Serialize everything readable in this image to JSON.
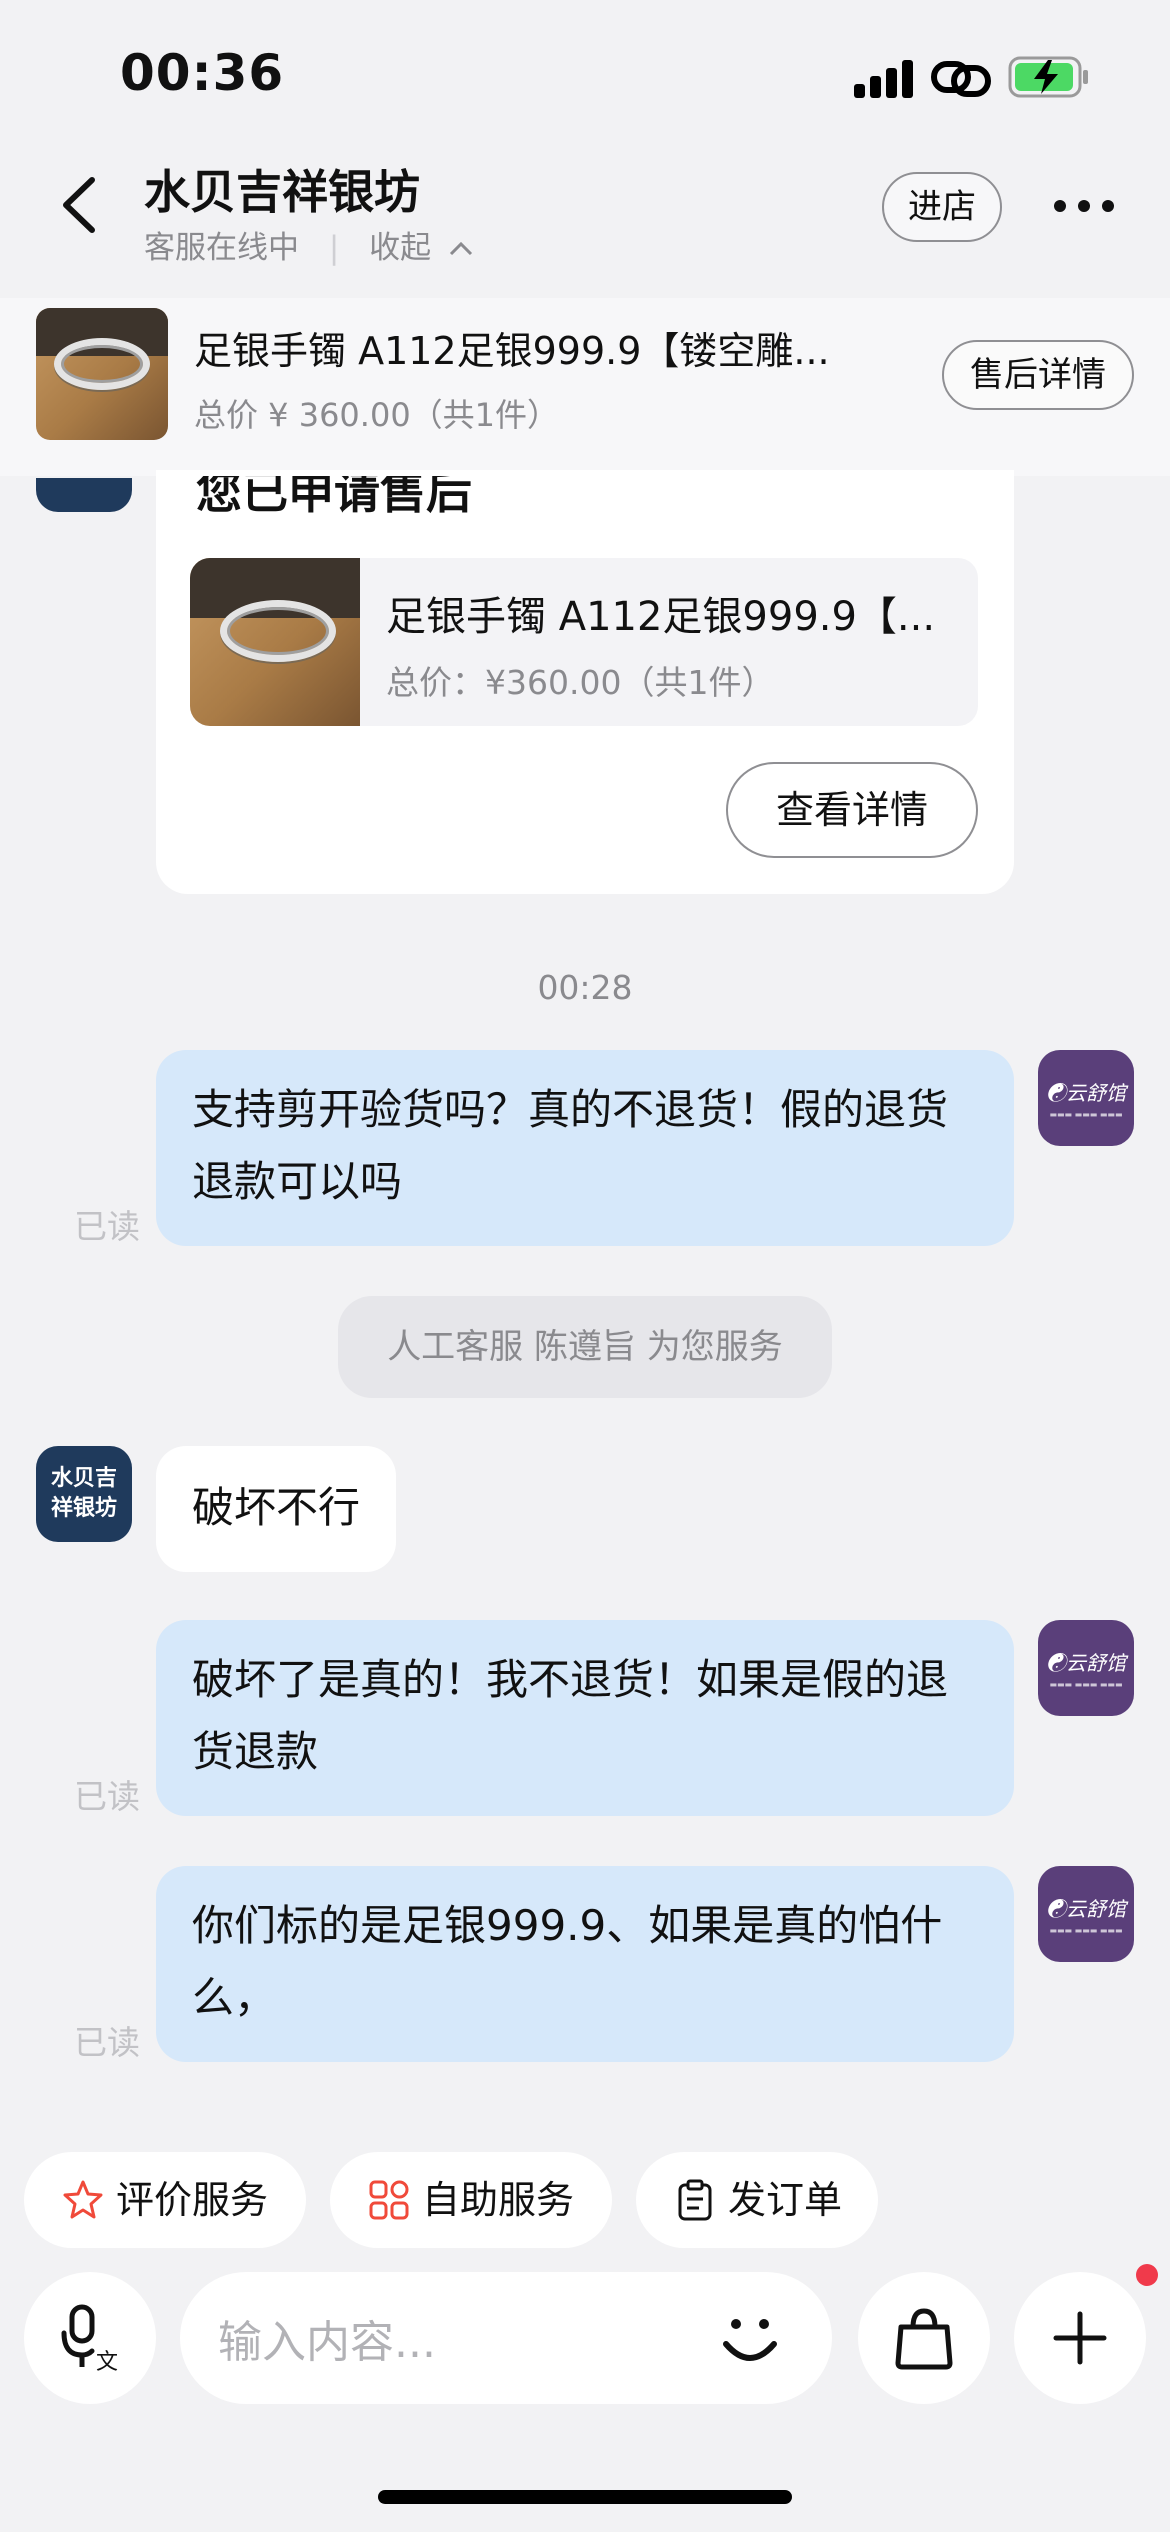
{
  "status_bar": {
    "time": "00:36"
  },
  "header": {
    "back_icon": "chevron-left-icon",
    "title": "水贝吉祥银坊",
    "status": "客服在线中",
    "collapse_label": "收起",
    "enter_shop": "进店",
    "more_icon": "more-dots-icon"
  },
  "product_bar": {
    "title": "足银手镯 A112足银999.9【镂空雕...",
    "price": "总价 ¥ 360.00（共1件）",
    "aftersale_button": "售后详情"
  },
  "shop_avatar_text_1": "水贝吉",
  "shop_avatar_text_2": "祥银坊",
  "user_avatar_text": "☯云舒馆",
  "card": {
    "title": "您已申请售后",
    "product_title": "足银手镯 A112足银999.9【...",
    "product_price": "总价：¥360.00（共1件）",
    "detail_button": "查看详情"
  },
  "messages": {
    "time_label": "00:28",
    "msg1": "支持剪开验货吗？真的不退货！假的退货退款可以吗",
    "system_notice": "人工客服 陈遵旨 为您服务",
    "msg2": "破坏不行",
    "msg3": "破坏了是真的！我不退货！如果是假的退货退款",
    "msg4": "你们标的是足银999.9、如果是真的怕什么，",
    "read_label": "已读"
  },
  "quick_actions": [
    {
      "label": "评价服务",
      "icon": "star-icon"
    },
    {
      "label": "自助服务",
      "icon": "grid-icon"
    },
    {
      "label": "发订单",
      "icon": "clipboard-icon"
    }
  ],
  "input_bar": {
    "voice_icon": "voice-to-text-icon",
    "placeholder": "输入内容...",
    "emoji_icon": "smile-icon",
    "bag_icon": "shopping-bag-icon",
    "plus_icon": "plus-icon"
  },
  "colors": {
    "background": "#f2f2f4",
    "my_bubble": "#d6e8fa",
    "shop_avatar": "#1f3a5c",
    "user_avatar": "#5a3f7a",
    "notification_dot": "#f03a4b"
  }
}
